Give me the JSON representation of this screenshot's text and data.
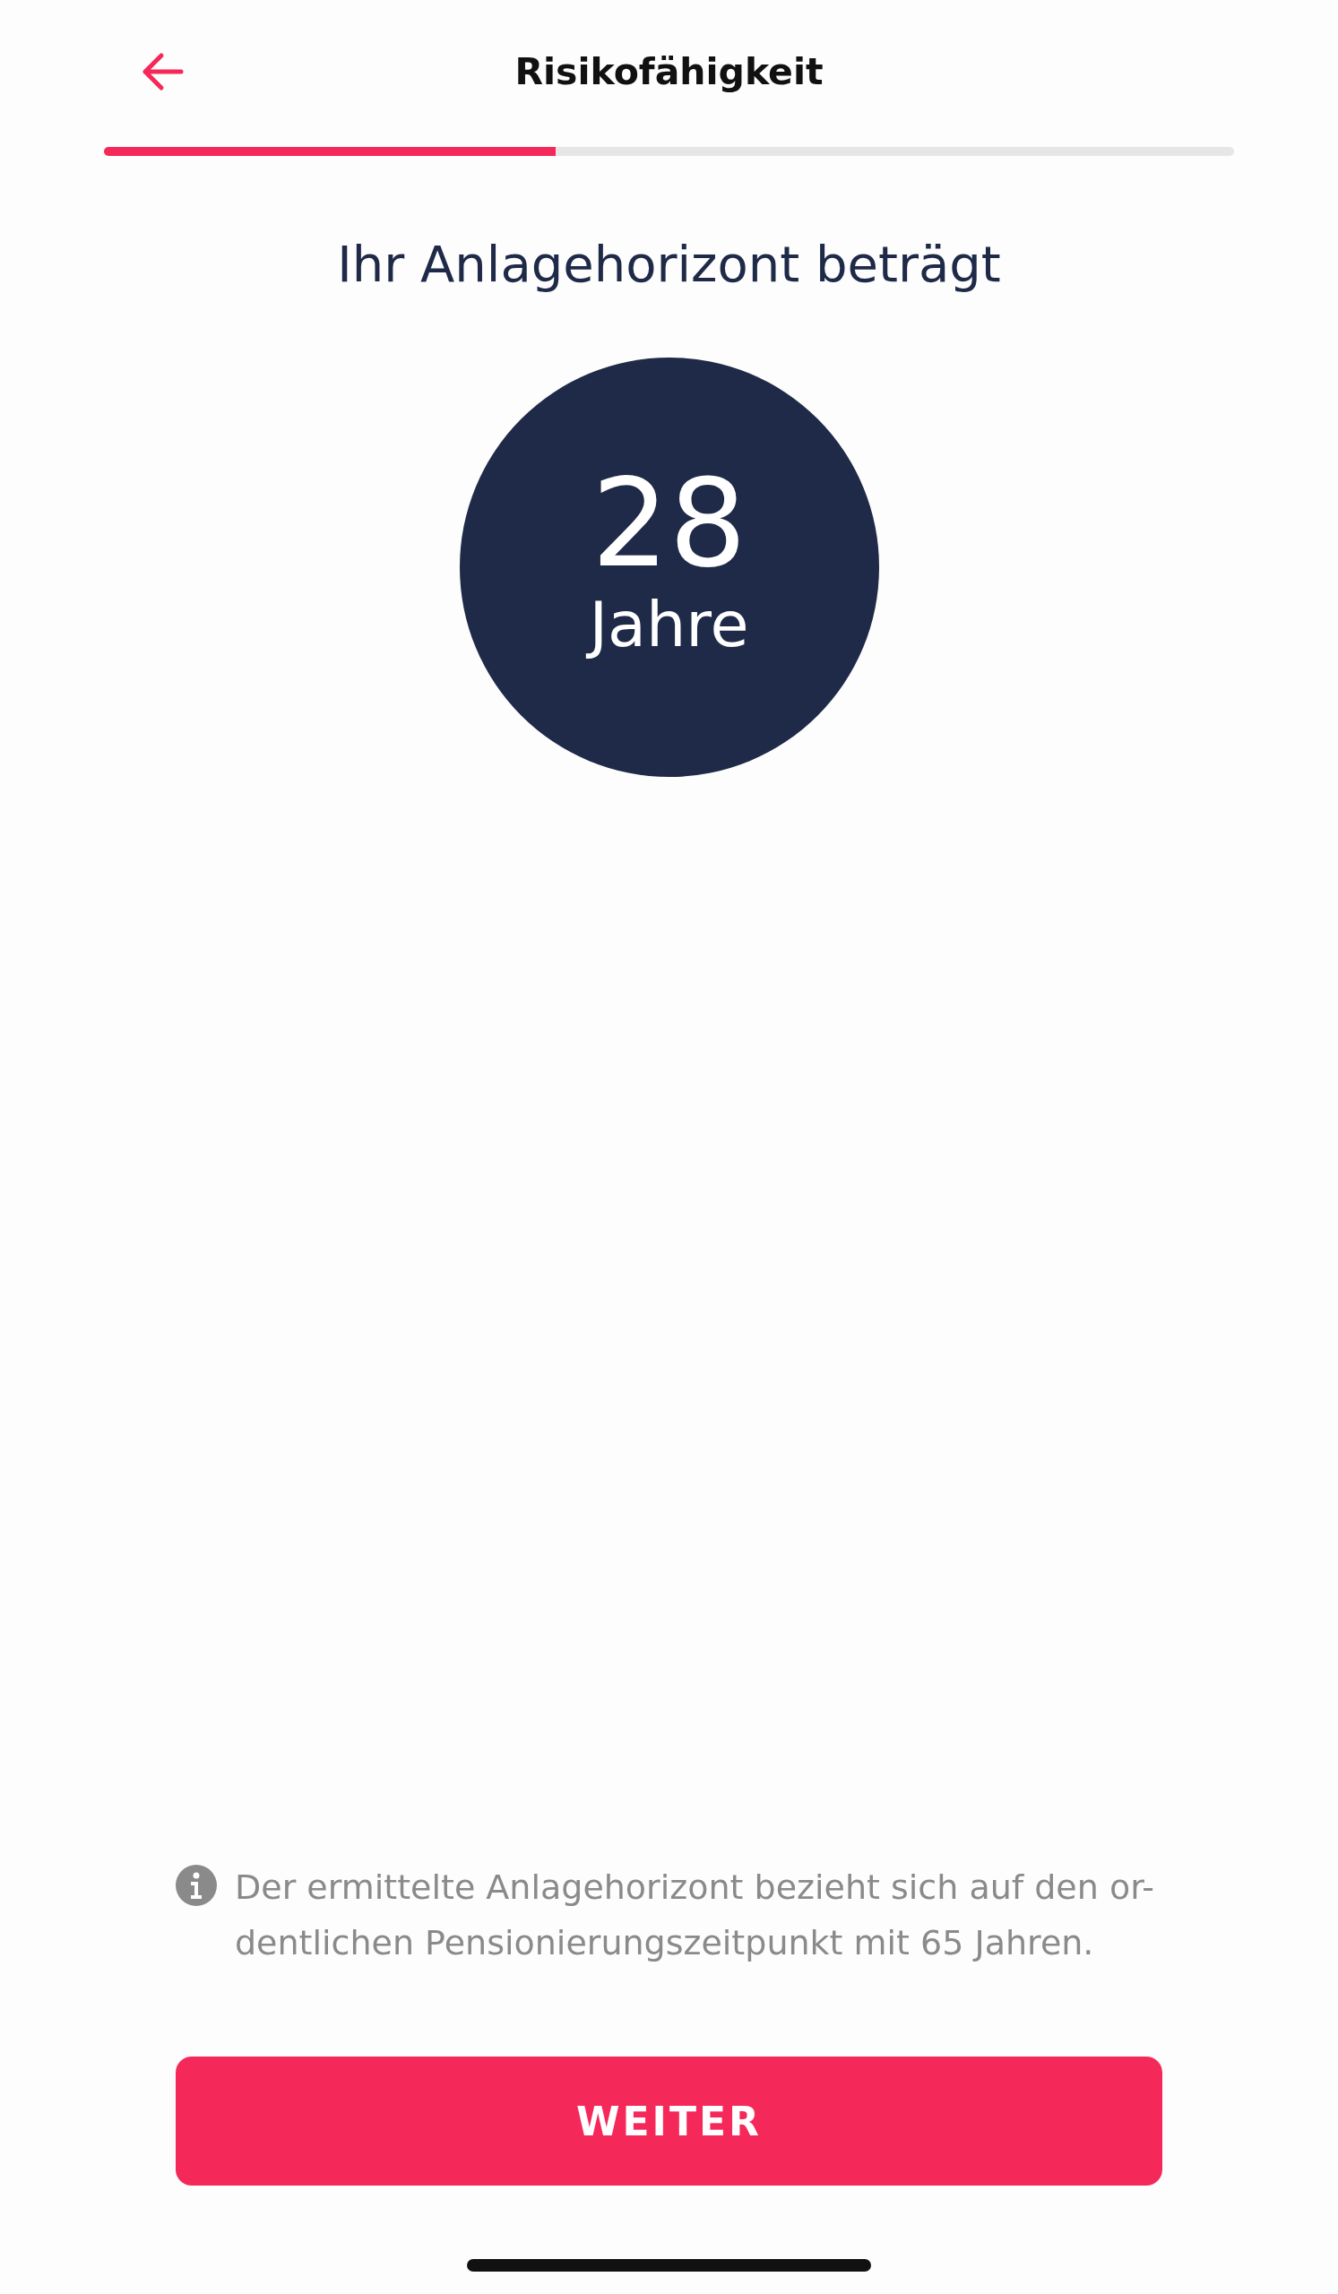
{
  "header": {
    "title": "Risikofähigkeit"
  },
  "progress": {
    "level": 0.4
  },
  "heading": "Ihr Anlagehorizont beträgt",
  "result": {
    "value": "28",
    "unit": "Jahre"
  },
  "info_text": "Der ermittelte Anlagehorizont bezieht sich auf den or-\ndentlichen Pensionierungszeitpunkt mit 65 Jahren.",
  "button": {
    "label": "WEITER"
  }
}
